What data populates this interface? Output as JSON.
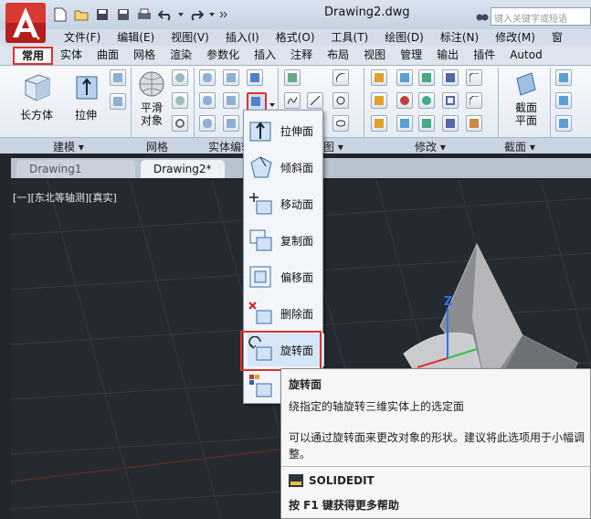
{
  "title": "Drawing2.dwg",
  "search": {
    "placeholder": "键入关键字或短语"
  },
  "menu": [
    "文件(F)",
    "编辑(E)",
    "视图(V)",
    "插入(I)",
    "格式(O)",
    "工具(T)",
    "绘图(D)",
    "标注(N)",
    "修改(M)",
    "窗"
  ],
  "ribbon_tabs": [
    "常用",
    "实体",
    "曲面",
    "网格",
    "渲染",
    "参数化",
    "插入",
    "注释",
    "布局",
    "视图",
    "管理",
    "输出",
    "插件",
    "Autod"
  ],
  "active_tab": "常用",
  "ribbon": {
    "box_label": "长方体",
    "extrude_label": "拉伸",
    "smooth_label": "平滑\n对象",
    "section_label": "截面\n平面",
    "panels": [
      "建模 ▾",
      "网格",
      "实体编辑",
      "图 ▾",
      "修改 ▾",
      "截面 ▾"
    ]
  },
  "doc_tabs": [
    "Drawing1",
    "Drawing2*"
  ],
  "viewport_label": "[一][东北等轴测][真实]",
  "flyout": [
    {
      "label": "拉伸面",
      "icon": "extrude-face-icon"
    },
    {
      "label": "倾斜面",
      "icon": "taper-face-icon"
    },
    {
      "label": "移动面",
      "icon": "move-face-icon"
    },
    {
      "label": "复制面",
      "icon": "copy-face-icon"
    },
    {
      "label": "偏移面",
      "icon": "offset-face-icon"
    },
    {
      "label": "删除面",
      "icon": "delete-face-icon"
    },
    {
      "label": "旋转面",
      "icon": "rotate-face-icon"
    },
    {
      "label": "",
      "icon": "color-face-icon"
    }
  ],
  "tooltip": {
    "title": "旋转面",
    "desc": "绕指定的轴旋转三维实体上的选定面",
    "detail1": "可以通过旋转面来更改对象的形状。建议将此选项用于小幅调",
    "detail2": "整。",
    "command": "SOLIDEDIT",
    "help": "按 F1 键获得更多帮助"
  },
  "colors": {
    "highlight": "#e0322c",
    "axis_x": "#e03030",
    "axis_y": "#30c040",
    "axis_z": "#3070ff"
  }
}
